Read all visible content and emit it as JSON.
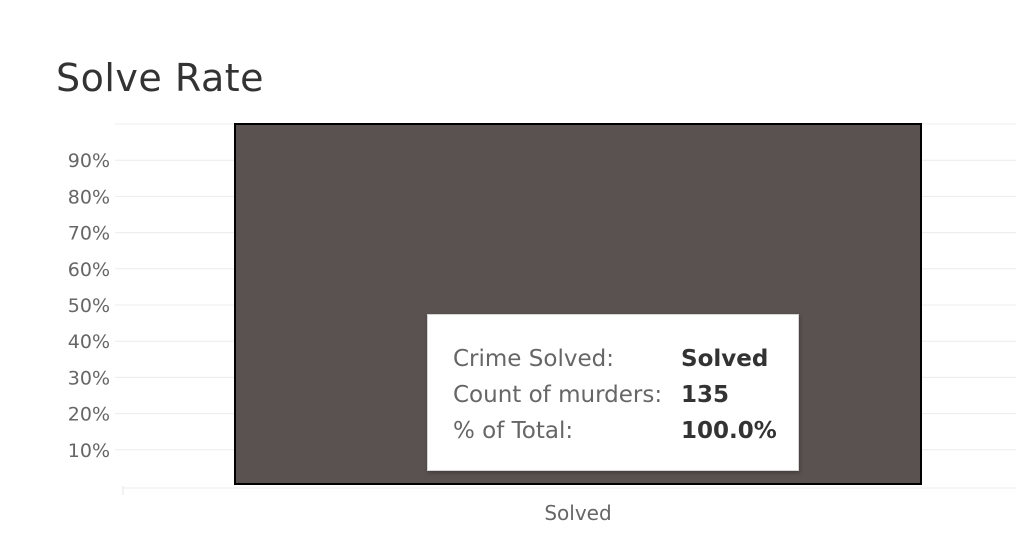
{
  "chart_data": {
    "type": "bar",
    "title": "Solve Rate",
    "categories": [
      "Solved"
    ],
    "values": [
      100.0
    ],
    "ylim": [
      0,
      100
    ],
    "yticks": [
      10,
      20,
      30,
      40,
      50,
      60,
      70,
      80,
      90
    ],
    "ytick_suffix": "%",
    "grid": true,
    "bar_color": "#5a5250",
    "bar_outline": "#000000"
  },
  "tooltip": {
    "rows": [
      {
        "key": "Crime Solved:",
        "value": "Solved"
      },
      {
        "key": "Count of murders:",
        "value": "135"
      },
      {
        "key": "% of Total:",
        "value": "100.0%"
      }
    ]
  }
}
